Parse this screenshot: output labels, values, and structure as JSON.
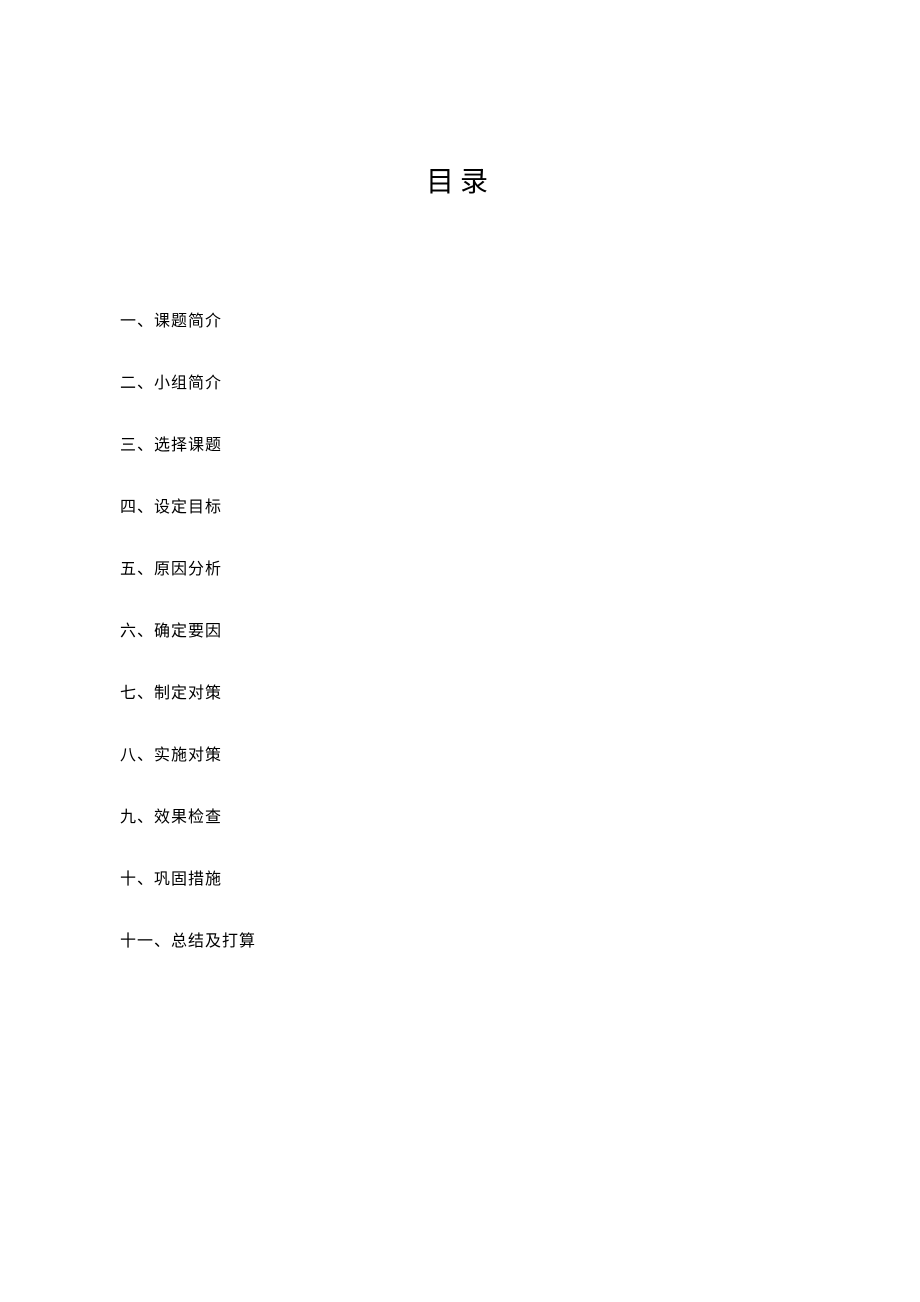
{
  "title": "目录",
  "toc": {
    "items": [
      "一、课题简介",
      "二、小组简介",
      "三、选择课题",
      "四、设定目标",
      "五、原因分析",
      "六、确定要因",
      "七、制定对策",
      "八、实施对策",
      "九、效果检查",
      "十、巩固措施",
      "十一、总结及打算"
    ]
  }
}
